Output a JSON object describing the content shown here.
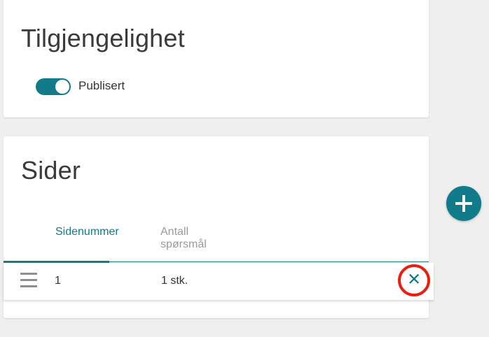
{
  "availability": {
    "title": "Tilgjengelighet",
    "published_label": "Publisert",
    "published": true
  },
  "pages": {
    "title": "Sider",
    "columns": [
      "Sidenummer",
      "Antall spørsmål"
    ],
    "rows": [
      {
        "page_number": "1",
        "question_count": "1 stk."
      }
    ]
  },
  "icons": {
    "drag": "drag-handle-icon",
    "remove": "close-icon",
    "add": "plus-icon"
  },
  "colors": {
    "accent": "#117b8a",
    "highlight_circle": "#e8210f",
    "background": "#efefef"
  }
}
